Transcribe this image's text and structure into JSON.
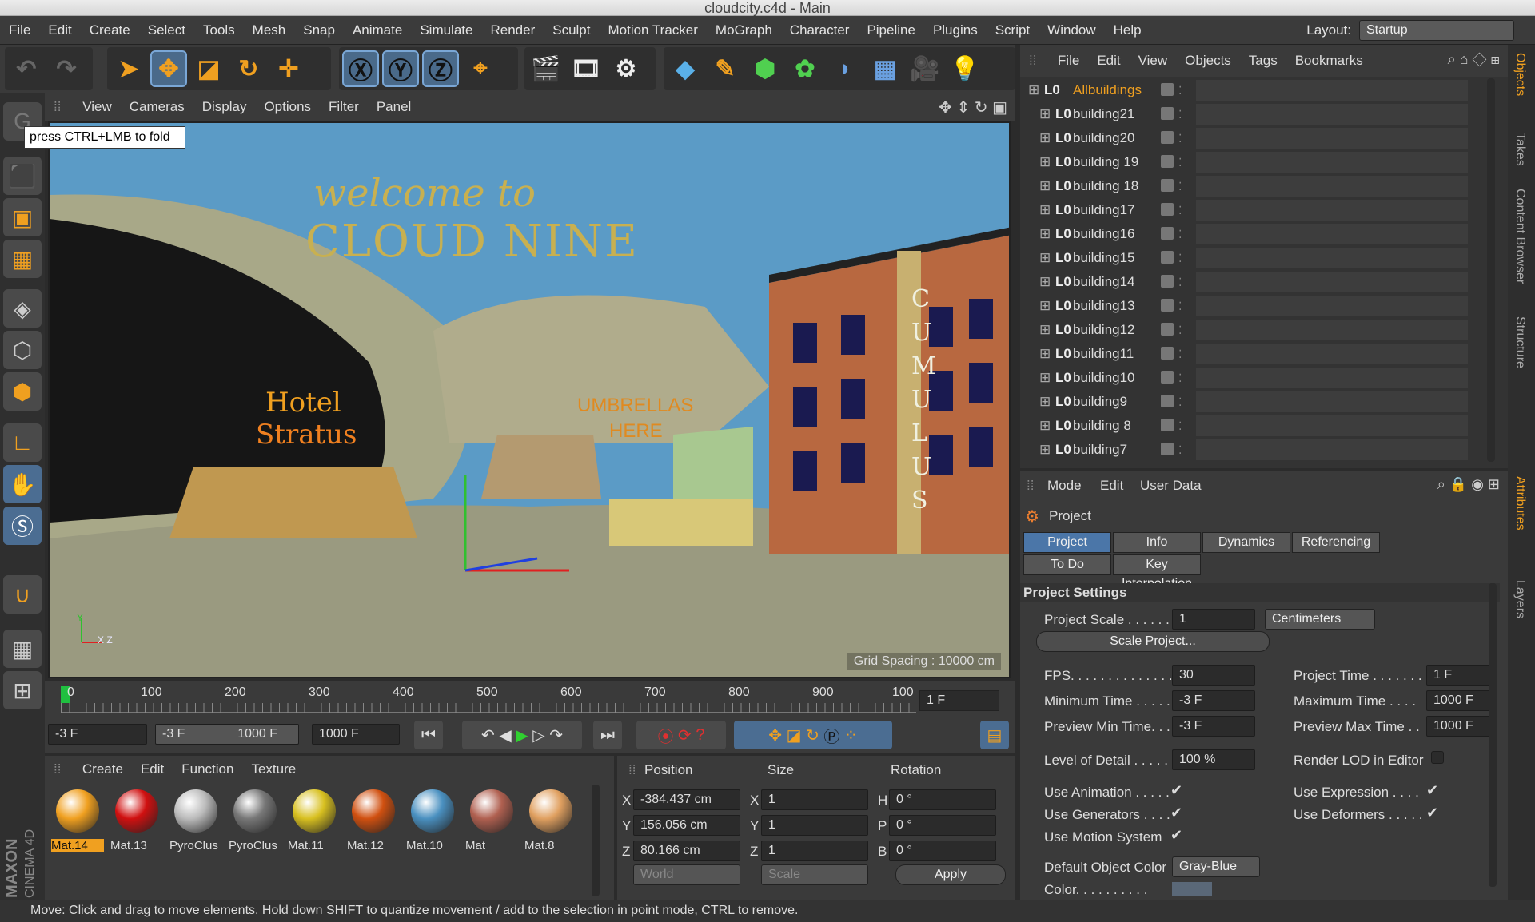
{
  "window": {
    "title": "cloudcity.c4d - Main"
  },
  "menu": [
    "File",
    "Edit",
    "Create",
    "Select",
    "Tools",
    "Mesh",
    "Snap",
    "Animate",
    "Simulate",
    "Render",
    "Sculpt",
    "Motion Tracker",
    "MoGraph",
    "Character",
    "Pipeline",
    "Plugins",
    "Script",
    "Window",
    "Help"
  ],
  "layout": {
    "label": "Layout:",
    "value": "Startup"
  },
  "viewport": {
    "menu": [
      "View",
      "Cameras",
      "Display",
      "Options",
      "Filter",
      "Panel"
    ],
    "tooltip": "press CTRL+LMB to fold",
    "grid_spacing": "Grid Spacing : 10000 cm",
    "sign1": "welcome to",
    "sign2": "CLOUD NINE",
    "hotel1": "Hotel",
    "hotel2": "Stratus",
    "umb1": "UMBRELLAS",
    "umb2": "HERE",
    "vsign": "CUMULUS",
    "axis_y": "Y",
    "axis_xz": "X Z"
  },
  "timeline": {
    "ticks": [
      "0",
      "100",
      "200",
      "300",
      "400",
      "500",
      "600",
      "700",
      "800",
      "900",
      "100"
    ],
    "current": "1 F"
  },
  "transport": {
    "start": "-3 F",
    "range_start": "-3 F",
    "range_end": "1000 F",
    "end": "1000 F"
  },
  "materials": {
    "menu": [
      "Create",
      "Edit",
      "Function",
      "Texture"
    ],
    "items": [
      {
        "name": "Mat.14",
        "color": "#f0a020"
      },
      {
        "name": "Mat.13",
        "color": "#d01010"
      },
      {
        "name": "PyroClus",
        "color": "#bbbbbb"
      },
      {
        "name": "PyroClus",
        "color": "#777777"
      },
      {
        "name": "Mat.11",
        "color": "#d8c020"
      },
      {
        "name": "Mat.12",
        "color": "#d05010"
      },
      {
        "name": "Mat.10",
        "color": "#4a90c0"
      },
      {
        "name": "Mat",
        "color": "#b06050"
      },
      {
        "name": "Mat.8",
        "color": "#e0a060"
      }
    ]
  },
  "coords": {
    "headers": [
      "Position",
      "Size",
      "Rotation"
    ],
    "pos": [
      {
        "axis": "X",
        "value": "-384.437 cm"
      },
      {
        "axis": "Y",
        "value": "156.056 cm"
      },
      {
        "axis": "Z",
        "value": "80.166 cm"
      }
    ],
    "size": [
      {
        "axis": "X",
        "value": "1"
      },
      {
        "axis": "Y",
        "value": "1"
      },
      {
        "axis": "Z",
        "value": "1"
      }
    ],
    "rot": [
      {
        "axis": "H",
        "value": "0 °"
      },
      {
        "axis": "P",
        "value": "0 °"
      },
      {
        "axis": "B",
        "value": "0 °"
      }
    ],
    "world": "World",
    "scale": "Scale",
    "apply": "Apply"
  },
  "status": "Move: Click and drag to move elements. Hold down SHIFT to quantize movement / add to the selection in point mode, CTRL to remove.",
  "objects": {
    "menu": [
      "File",
      "Edit",
      "View",
      "Objects",
      "Tags",
      "Bookmarks"
    ],
    "items": [
      "Allbuildings",
      "building21",
      "building20",
      "building 19",
      "building 18",
      "building17",
      "building16",
      "building15",
      "building14",
      "building13",
      "building12",
      "building11",
      "building10",
      "building9",
      "building 8",
      "building7"
    ]
  },
  "attributes": {
    "menu": [
      "Mode",
      "Edit",
      "User Data"
    ],
    "object": "Project",
    "tabs": [
      "Project Settings",
      "Info",
      "Dynamics",
      "Referencing",
      "To Do",
      "Key Interpolation"
    ],
    "section": "Project Settings",
    "project_scale_label": "Project Scale . . . . . .",
    "project_scale": "1",
    "unit": "Centimeters",
    "scale_btn": "Scale Project...",
    "fps_label": "FPS. . . . . . . . . . . . . . .",
    "fps": "30",
    "project_time_label": "Project Time . . . . . . .",
    "project_time": "1 F",
    "min_time_label": "Minimum Time . . . . .",
    "min_time": "-3 F",
    "max_time_label": "Maximum Time . . . .",
    "max_time": "1000 F",
    "pmin_label": "Preview Min Time. . .",
    "pmin": "-3 F",
    "pmax_label": "Preview Max Time . .",
    "pmax": "1000 F",
    "lod_label": "Level of Detail . . . . .",
    "lod": "100 %",
    "rlod_label": "Render LOD in Editor",
    "use_anim": "Use Animation . . . . .",
    "use_expr": "Use Expression . . . .",
    "use_gen": "Use Generators . . . .",
    "use_def": "Use Deformers . . . . .",
    "use_motion": "Use Motion System",
    "def_color_label": "Default Object Color",
    "def_color": "Gray-Blue",
    "color_label": "Color. . . . . . . . . ."
  },
  "sidetabs": [
    "Objects",
    "Takes",
    "Content Browser",
    "Structure",
    "Attributes",
    "Layers"
  ],
  "brand": [
    "MAXON",
    "CINEMA 4D"
  ]
}
